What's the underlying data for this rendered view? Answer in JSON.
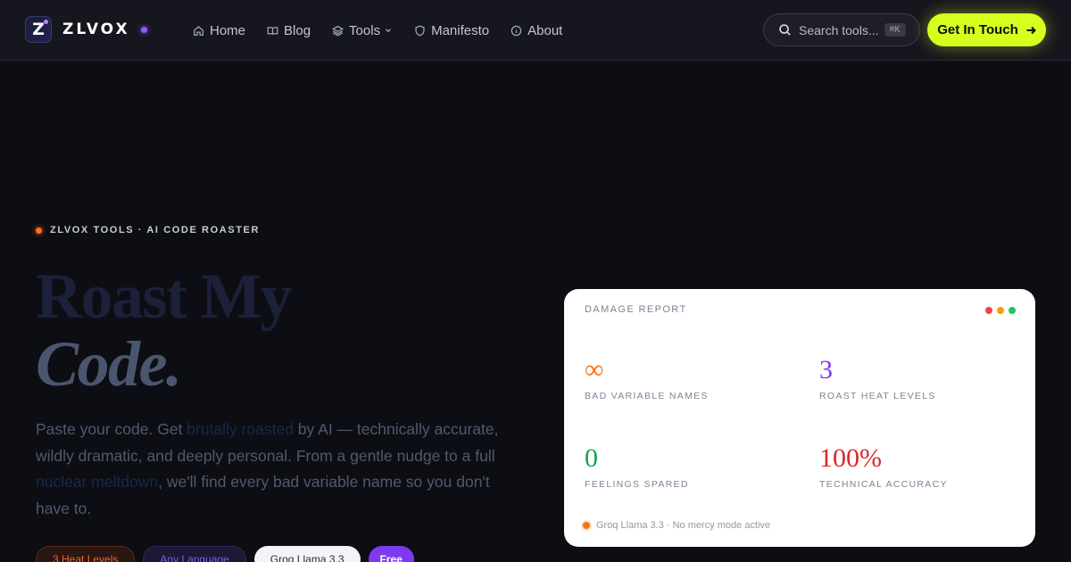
{
  "brand": {
    "mark": "Z",
    "name": "ZLVOX"
  },
  "nav": {
    "items": [
      {
        "label": "Home",
        "icon": "home-icon"
      },
      {
        "label": "Blog",
        "icon": "book-icon"
      },
      {
        "label": "Tools",
        "icon": "layers-icon",
        "has_dropdown": true
      },
      {
        "label": "Manifesto",
        "icon": "shield-icon"
      },
      {
        "label": "About",
        "icon": "info-icon"
      }
    ],
    "search": {
      "placeholder": "Search tools...",
      "shortcut": "⌘K"
    },
    "cta": {
      "label": "Get In Touch"
    }
  },
  "hero": {
    "eyebrow": "ZLVOX TOOLS · AI CODE ROASTER",
    "title_line1": "Roast My",
    "title_line2": "Code.",
    "description": {
      "p1": "Paste your code. Get ",
      "highlight1": "brutally roasted",
      "p2": " by AI — technically accurate, wildly dramatic, and deeply personal. From a gentle nudge to a full ",
      "highlight2": "nuclear meltdown",
      "p3": ", we'll find every bad variable name so you don't have to."
    },
    "chips": [
      "3 Heat Levels",
      "Any Language",
      "Groq Llama 3.3",
      "Free"
    ]
  },
  "damage_report": {
    "title": "DAMAGE REPORT",
    "stats": [
      {
        "value": "∞",
        "label": "BAD VARIABLE NAMES",
        "color": "#f97316"
      },
      {
        "value": "3",
        "label": "ROAST HEAT LEVELS",
        "color": "#7c3aed"
      },
      {
        "value": "0",
        "label": "FEELINGS SPARED",
        "color": "#16a34a"
      },
      {
        "value": "100%",
        "label": "TECHNICAL ACCURACY",
        "color": "#dc2626"
      }
    ],
    "footer": "Groq Llama 3.3 · No mercy mode active"
  },
  "colors": {
    "accent_lime": "#d7ff1e",
    "accent_purple": "#7c3aed",
    "accent_orange": "#f97316",
    "light_red": "#ef4444",
    "light_yellow": "#f59e0b",
    "light_green": "#22c55e"
  }
}
